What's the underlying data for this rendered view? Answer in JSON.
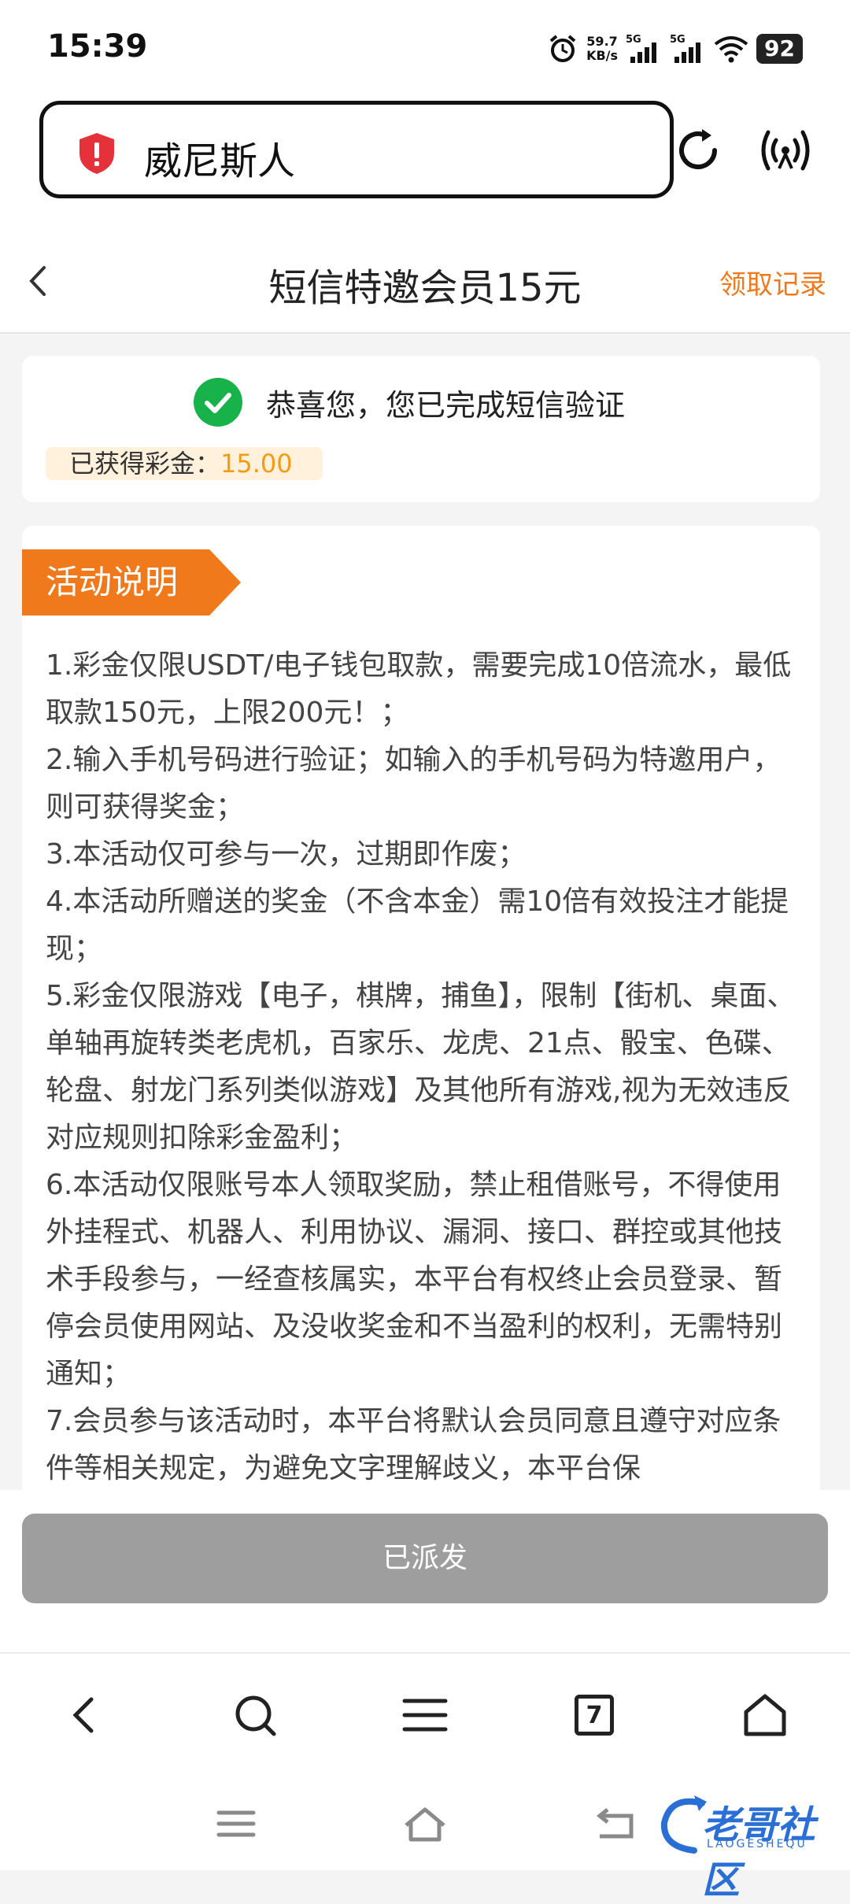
{
  "status_bar": {
    "time": "15:39",
    "net_speed": "59.7",
    "net_speed_unit": "KB/s",
    "signal1": "5G",
    "signal2": "5G",
    "battery": "92"
  },
  "browser": {
    "url_title": "威尼斯人",
    "tab_count": "7"
  },
  "nav": {
    "title": "短信特邀会员15元",
    "record_link": "领取记录"
  },
  "verify_card": {
    "message": "恭喜您，您已完成短信验证",
    "reward_label": "已获得彩金：",
    "reward_value": "15.00"
  },
  "activity": {
    "heading": "活动说明",
    "rules": [
      "1.彩金仅限USDT/电子钱包取款，需要完成10倍流水，最低取款150元，上限200元！；",
      "2.输入手机号码进行验证；如输入的手机号码为特邀用户，则可获得奖金；",
      "3.本活动仅可参与一次，过期即作废；",
      "4.本活动所赠送的奖金（不含本金）需10倍有效投注才能提现；",
      "5.彩金仅限游戏【电子，棋牌，捕鱼】，限制【街机、桌面、单轴再旋转类老虎机，百家乐、龙虎、21点、骰宝、色碟、轮盘、射龙门系列类似游戏】及其他所有游戏,视为无效违反对应规则扣除彩金盈利；",
      "6.本活动仅限账号本人领取奖励，禁止租借账号，不得使用外挂程式、机器人、利用协议、漏洞、接口、群控或其他技术手段参与，一经查核属实，本平台有权终止会员登录、暂停会员使用网站、及没收奖金和不当盈利的权利，无需特别通知；",
      "7.会员参与该活动时，本平台将默认会员同意且遵守对应条件等相关规定，为避免文字理解歧义，本平台保"
    ]
  },
  "action": {
    "button_label": "已派发"
  },
  "watermark": {
    "text": "老哥社区",
    "sub": "LAOGESHEQU"
  },
  "colors": {
    "accent": "#f0791c",
    "reward": "#f29b16",
    "success": "#17b34a",
    "shield": "#e5323a",
    "disabled": "#9e9e9e"
  }
}
